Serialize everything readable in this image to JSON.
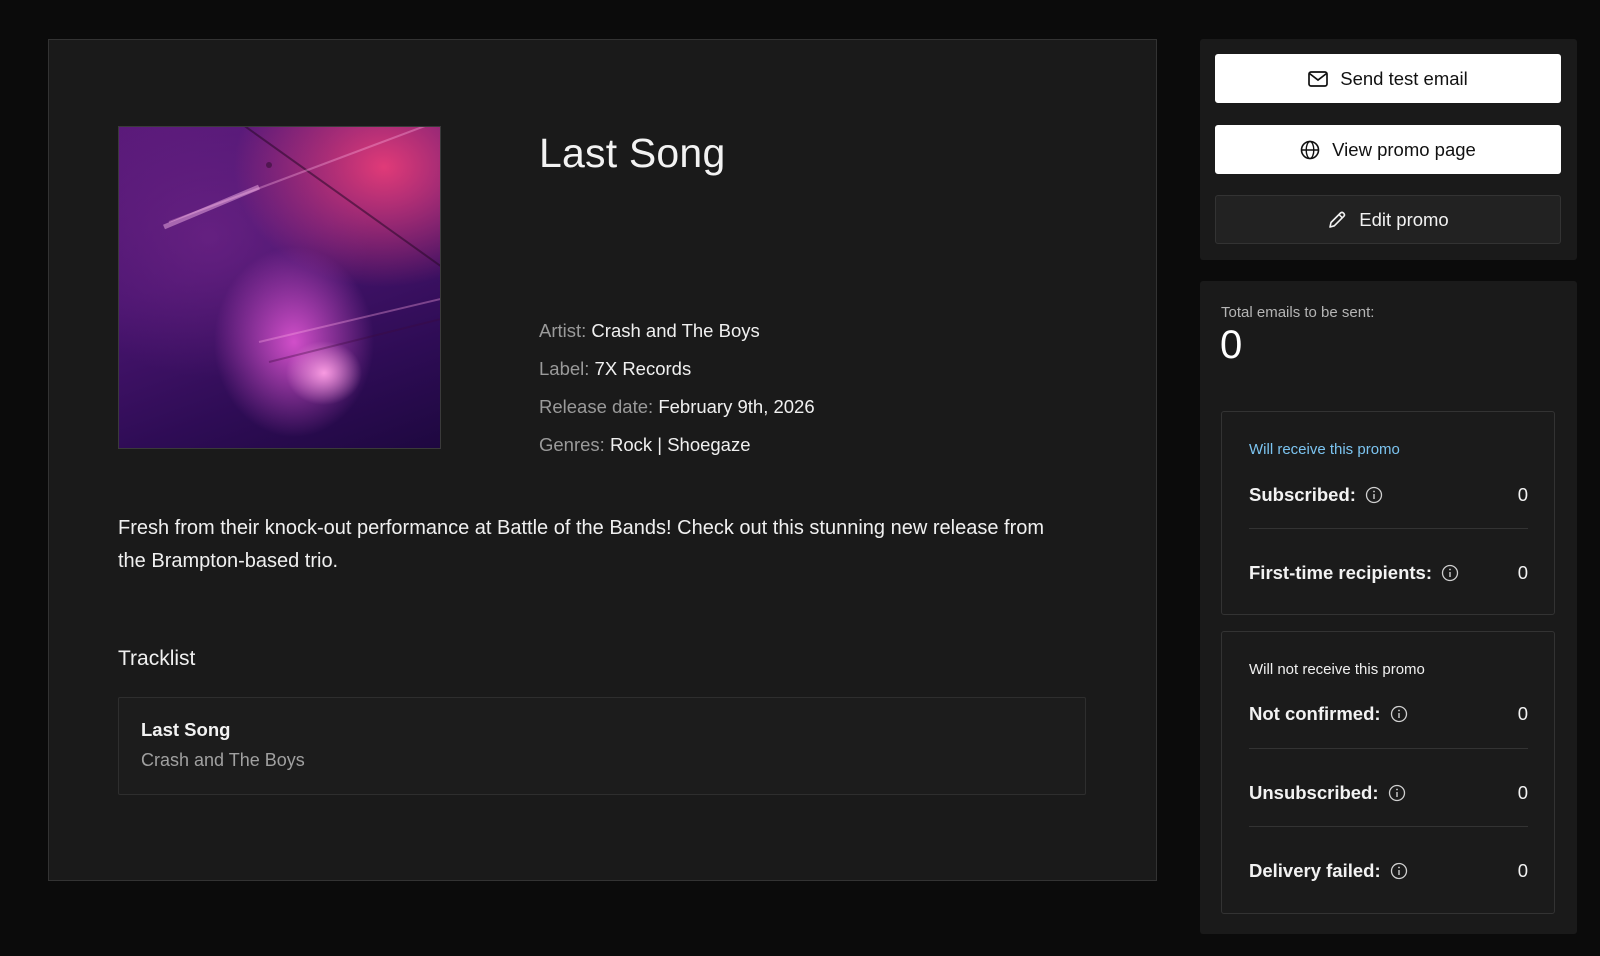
{
  "promo": {
    "title": "Last Song",
    "meta": {
      "artist_key": "Artist:",
      "artist_value": "Crash and The Boys",
      "label_key": "Label:",
      "label_value": "7X Records",
      "release_key": "Release date:",
      "release_value": "February 9th, 2026",
      "genres_key": "Genres:",
      "genres_value": "Rock | Shoegaze"
    },
    "description": "Fresh from their knock-out performance at Battle of the Bands! Check out this stunning new release from the Brampton-based trio.",
    "tracklist_heading": "Tracklist",
    "tracks": [
      {
        "title": "Last Song",
        "artist": "Crash and The Boys"
      }
    ]
  },
  "actions": {
    "send_test_email": "Send test email",
    "view_promo_page": "View promo page",
    "edit_promo": "Edit promo"
  },
  "stats": {
    "total_label": "Total emails to be sent:",
    "total_value": "0",
    "will_receive": {
      "title": "Will receive this promo",
      "items": [
        {
          "label": "Subscribed:",
          "value": "0"
        },
        {
          "label": "First-time recipients:",
          "value": "0"
        }
      ]
    },
    "will_not_receive": {
      "title": "Will not receive this promo",
      "items": [
        {
          "label": "Not confirmed:",
          "value": "0"
        },
        {
          "label": "Unsubscribed:",
          "value": "0"
        },
        {
          "label": "Delivery failed:",
          "value": "0"
        }
      ]
    }
  },
  "colors": {
    "background": "#0b0b0b",
    "panel": "#1a1a1a",
    "accent_blue": "#7cc4f0"
  },
  "icons": {
    "send": "mail-icon",
    "view": "globe-icon",
    "edit": "pencil-icon",
    "info": "info-icon"
  }
}
